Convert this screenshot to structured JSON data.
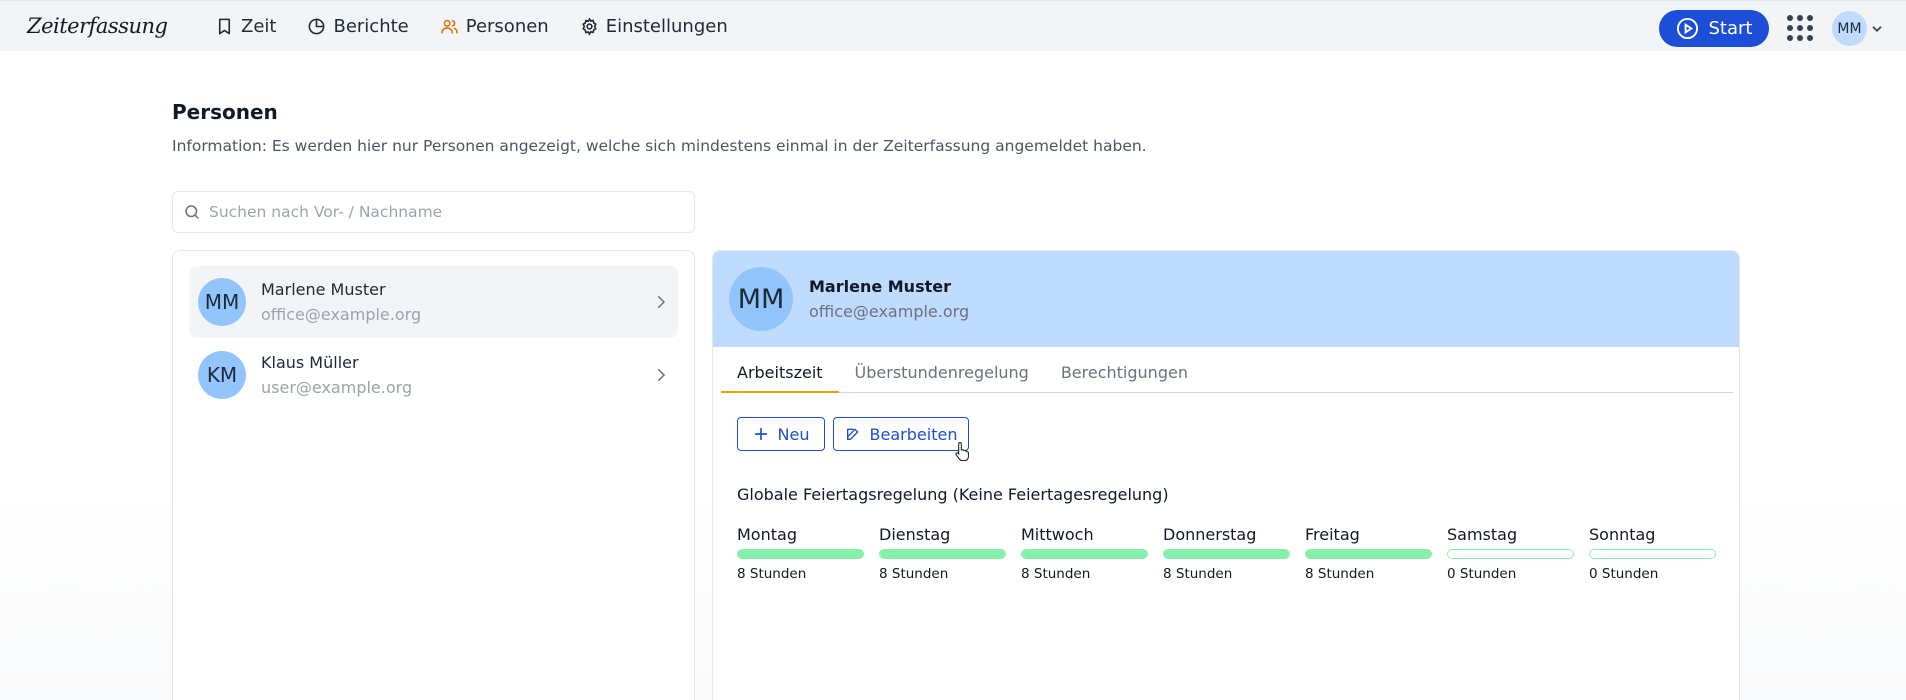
{
  "app": {
    "logo": "Zeiterfassung"
  },
  "nav": {
    "items": [
      {
        "label": "Zeit",
        "icon": "bookmark-icon"
      },
      {
        "label": "Berichte",
        "icon": "pie-chart-icon"
      },
      {
        "label": "Personen",
        "icon": "users-icon"
      },
      {
        "label": "Einstellungen",
        "icon": "gear-icon"
      }
    ],
    "start_label": "Start",
    "user_initials": "MM"
  },
  "page": {
    "title": "Personen",
    "info": "Information: Es werden hier nur Personen angezeigt, welche sich mindestens einmal in der Zeiterfassung angemeldet haben."
  },
  "search": {
    "placeholder": "Suchen nach Vor- / Nachname",
    "value": ""
  },
  "persons": [
    {
      "initials": "MM",
      "name": "Marlene Muster",
      "email": "office@example.org",
      "selected": true
    },
    {
      "initials": "KM",
      "name": "Klaus Müller",
      "email": "user@example.org",
      "selected": false
    }
  ],
  "detail": {
    "initials": "MM",
    "name": "Marlene Muster",
    "email": "office@example.org",
    "tabs": [
      {
        "label": "Arbeitszeit",
        "active": true
      },
      {
        "label": "Überstundenregelung",
        "active": false
      },
      {
        "label": "Berechtigungen",
        "active": false
      }
    ],
    "new_label": "Neu",
    "edit_label": "Bearbeiten",
    "holiday_rule": "Globale Feiertagsregelung (Keine Feiertagesregelung)",
    "days": [
      {
        "label": "Montag",
        "hours": "8 Stunden",
        "fill": 1
      },
      {
        "label": "Dienstag",
        "hours": "8 Stunden",
        "fill": 1
      },
      {
        "label": "Mittwoch",
        "hours": "8 Stunden",
        "fill": 1
      },
      {
        "label": "Donnerstag",
        "hours": "8 Stunden",
        "fill": 1
      },
      {
        "label": "Freitag",
        "hours": "8 Stunden",
        "fill": 1
      },
      {
        "label": "Samstag",
        "hours": "0 Stunden",
        "fill": 0
      },
      {
        "label": "Sonntag",
        "hours": "0 Stunden",
        "fill": 0
      }
    ]
  },
  "colors": {
    "accent": "#1d4ed8",
    "avatar": "#93c5fd",
    "header": "#bfdbfe",
    "bar": "#86efac",
    "tab_active": "#f59e0b"
  }
}
